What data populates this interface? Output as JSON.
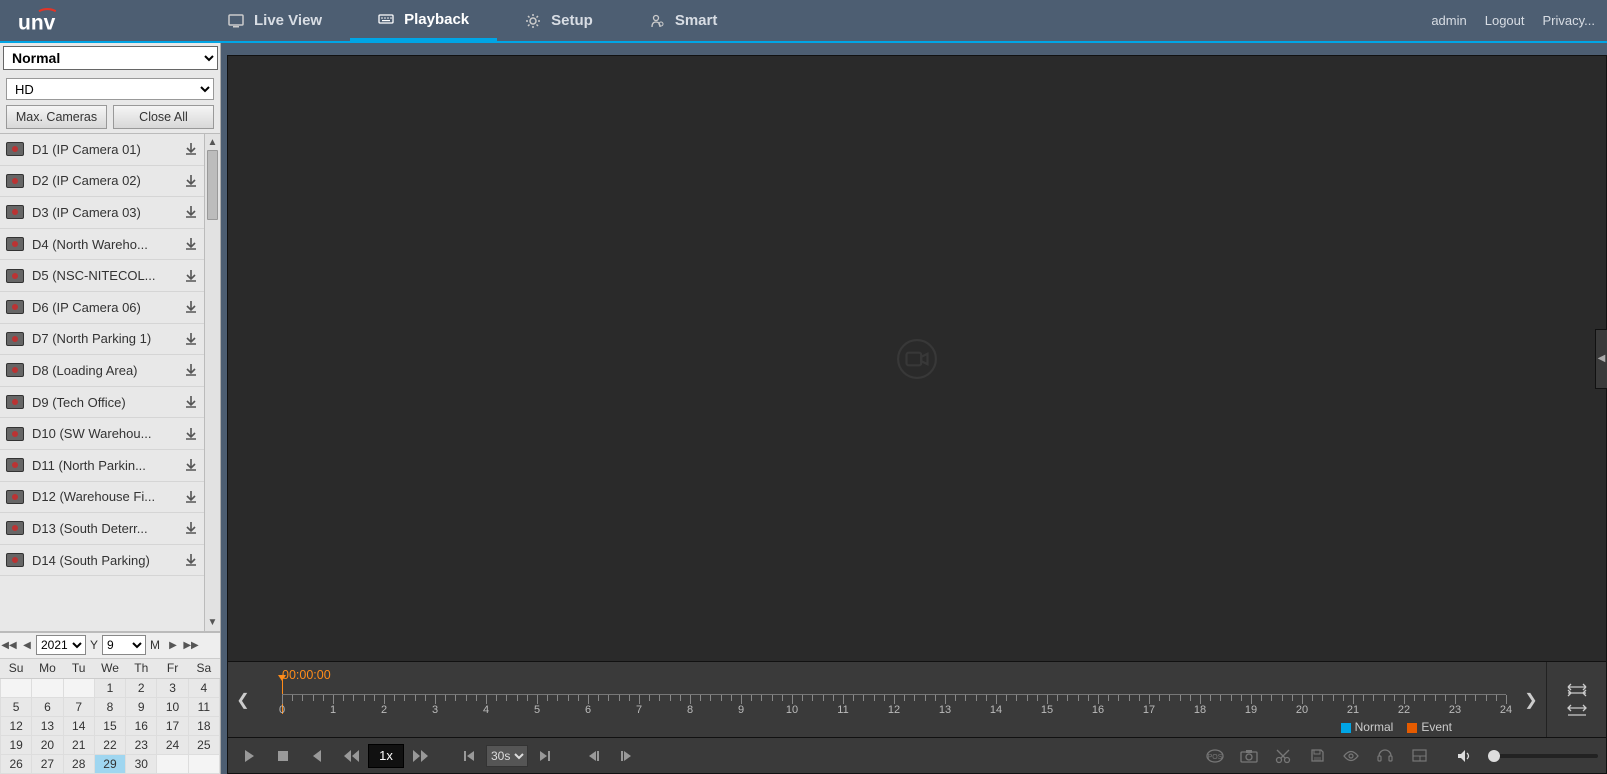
{
  "header": {
    "tabs": [
      {
        "id": "liveview",
        "label": "Live View"
      },
      {
        "id": "playback",
        "label": "Playback"
      },
      {
        "id": "setup",
        "label": "Setup"
      },
      {
        "id": "smart",
        "label": "Smart"
      }
    ],
    "active_tab": "playback",
    "user": "admin",
    "logout": "Logout",
    "privacy": "Privacy..."
  },
  "sidebar": {
    "mode_select": "Normal",
    "quality_select": "HD",
    "max_cameras_btn": "Max. Cameras",
    "close_all_btn": "Close All",
    "cameras": [
      {
        "label": "D1 (IP Camera 01)"
      },
      {
        "label": "D2 (IP Camera 02)"
      },
      {
        "label": "D3 (IP Camera 03)"
      },
      {
        "label": "D4 (North Wareho..."
      },
      {
        "label": "D5 (NSC-NITECOL..."
      },
      {
        "label": "D6 (IP Camera 06)"
      },
      {
        "label": "D7 (North Parking 1)"
      },
      {
        "label": "D8 (Loading Area)"
      },
      {
        "label": "D9 (Tech Office)"
      },
      {
        "label": "D10 (SW Warehou..."
      },
      {
        "label": "D11 (North Parkin..."
      },
      {
        "label": "D12 (Warehouse Fi..."
      },
      {
        "label": "D13 (South Deterr..."
      },
      {
        "label": "D14 (South Parking)"
      }
    ]
  },
  "calendar": {
    "year": "2021",
    "year_label": "Y",
    "month": "9",
    "month_label": "M",
    "weekdays": [
      "Su",
      "Mo",
      "Tu",
      "We",
      "Th",
      "Fr",
      "Sa"
    ],
    "rows": [
      [
        "",
        "",
        "",
        "1",
        "2",
        "3",
        "4"
      ],
      [
        "5",
        "6",
        "7",
        "8",
        "9",
        "10",
        "11"
      ],
      [
        "12",
        "13",
        "14",
        "15",
        "16",
        "17",
        "18"
      ],
      [
        "19",
        "20",
        "21",
        "22",
        "23",
        "24",
        "25"
      ],
      [
        "26",
        "27",
        "28",
        "29",
        "30",
        "",
        ""
      ]
    ],
    "selected": "29"
  },
  "timeline": {
    "time": "00:00:00",
    "hours": [
      "0",
      "1",
      "2",
      "3",
      "4",
      "5",
      "6",
      "7",
      "8",
      "9",
      "10",
      "11",
      "12",
      "13",
      "14",
      "15",
      "16",
      "17",
      "18",
      "19",
      "20",
      "21",
      "22",
      "23",
      "24"
    ],
    "legend_normal": "Normal",
    "legend_event": "Event"
  },
  "controls": {
    "speed": "1x",
    "step_select": "30s"
  }
}
